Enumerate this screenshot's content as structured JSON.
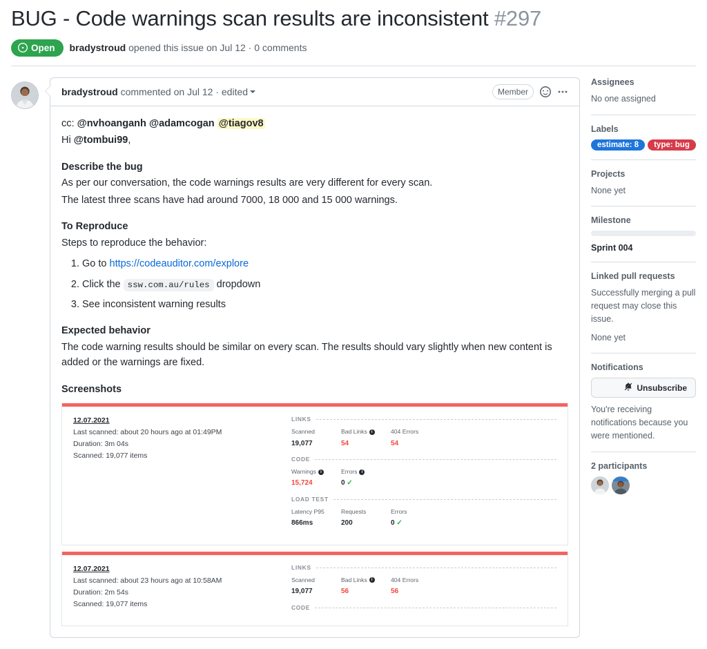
{
  "issue": {
    "title": "BUG - Code warnings scan results are inconsistent",
    "number": "#297",
    "state": "Open",
    "author": "bradystroud",
    "meta_action": "opened this issue on Jul 12",
    "meta_comments": "0 comments",
    "meta_separator": "·"
  },
  "comment": {
    "author": "bradystroud",
    "action": "commented on Jul 12",
    "separator": "·",
    "edited": "edited",
    "badge": "Member",
    "reaction_icon": "smiley-icon",
    "menu_icon": "kebab-horizontal-icon",
    "body": {
      "cc_prefix": "cc: ",
      "cc_mentions": [
        "@nvhoanganh",
        "@adamcogan"
      ],
      "cc_highlight": "@tiagov8",
      "greeting_prefix": "Hi ",
      "greeting_mention": "@tombui99",
      "greeting_suffix": ",",
      "describe_heading": "Describe the bug",
      "describe_line1": "As per our conversation, the code warnings results are very different for every scan.",
      "describe_line2": "The latest three scans have had around 7000, 18 000 and 15 000 warnings.",
      "reproduce_heading": "To Reproduce",
      "reproduce_intro": "Steps to reproduce the behavior:",
      "step1_prefix": "Go to ",
      "step1_link": "https://codeauditor.com/explore",
      "step2_prefix": "Click the ",
      "step2_code": "ssw.com.au/rules",
      "step2_suffix": " dropdown",
      "step3": "See inconsistent warning results",
      "expected_heading": "Expected behavior",
      "expected_text": "The code warning results should be similar on every scan. The results should vary slightly when new content is added or the warnings are fixed.",
      "screenshots_heading": "Screenshots"
    }
  },
  "scans": [
    {
      "date": "12.07.2021",
      "last_scanned": "Last scanned: about 20 hours ago at 01:49PM",
      "duration": "Duration: 3m 04s",
      "scanned": "Scanned: 19,077 items",
      "groups": [
        {
          "name": "LINKS",
          "metrics": [
            {
              "label": "Scanned",
              "value": "19,077",
              "red": false,
              "info": false,
              "tick": false
            },
            {
              "label": "Bad Links",
              "value": "54",
              "red": true,
              "info": true,
              "tick": false
            },
            {
              "label": "404 Errors",
              "value": "54",
              "red": true,
              "info": false,
              "tick": false
            }
          ]
        },
        {
          "name": "CODE",
          "metrics": [
            {
              "label": "Warnings",
              "value": "15,724",
              "red": true,
              "info": true,
              "tick": false
            },
            {
              "label": "Errors",
              "value": "0",
              "red": false,
              "info": true,
              "tick": true
            }
          ]
        },
        {
          "name": "LOAD TEST",
          "metrics": [
            {
              "label": "Latency P95",
              "value": "866ms",
              "red": false,
              "info": false,
              "tick": false
            },
            {
              "label": "Requests",
              "value": "200",
              "red": false,
              "info": false,
              "tick": false
            },
            {
              "label": "Errors",
              "value": "0",
              "red": false,
              "info": false,
              "tick": true
            }
          ]
        }
      ]
    },
    {
      "date": "12.07.2021",
      "last_scanned": "Last scanned: about 23 hours ago at 10:58AM",
      "duration": "Duration: 2m 54s",
      "scanned": "Scanned: 19,077 items",
      "groups": [
        {
          "name": "LINKS",
          "metrics": [
            {
              "label": "Scanned",
              "value": "19,077",
              "red": false,
              "info": false,
              "tick": false
            },
            {
              "label": "Bad Links",
              "value": "56",
              "red": true,
              "info": true,
              "tick": false
            },
            {
              "label": "404 Errors",
              "value": "56",
              "red": true,
              "info": false,
              "tick": false
            }
          ]
        },
        {
          "name": "CODE",
          "metrics": []
        }
      ]
    }
  ],
  "sidebar": {
    "assignees_title": "Assignees",
    "assignees_value": "No one assigned",
    "labels_title": "Labels",
    "labels": [
      {
        "text": "estimate: 8",
        "color": "#1d76db"
      },
      {
        "text": "type: bug",
        "color": "#d73a49"
      }
    ],
    "projects_title": "Projects",
    "projects_value": "None yet",
    "milestone_title": "Milestone",
    "milestone_name": "Sprint 004",
    "linked_pr_title": "Linked pull requests",
    "linked_pr_text": "Successfully merging a pull request may close this issue.",
    "linked_pr_value": "None yet",
    "notifications_title": "Notifications",
    "notifications_button": "Unsubscribe",
    "notifications_icon": "bell-slash-icon",
    "notifications_text": "You're receiving notifications because you were mentioned.",
    "participants_title": "2 participants"
  }
}
